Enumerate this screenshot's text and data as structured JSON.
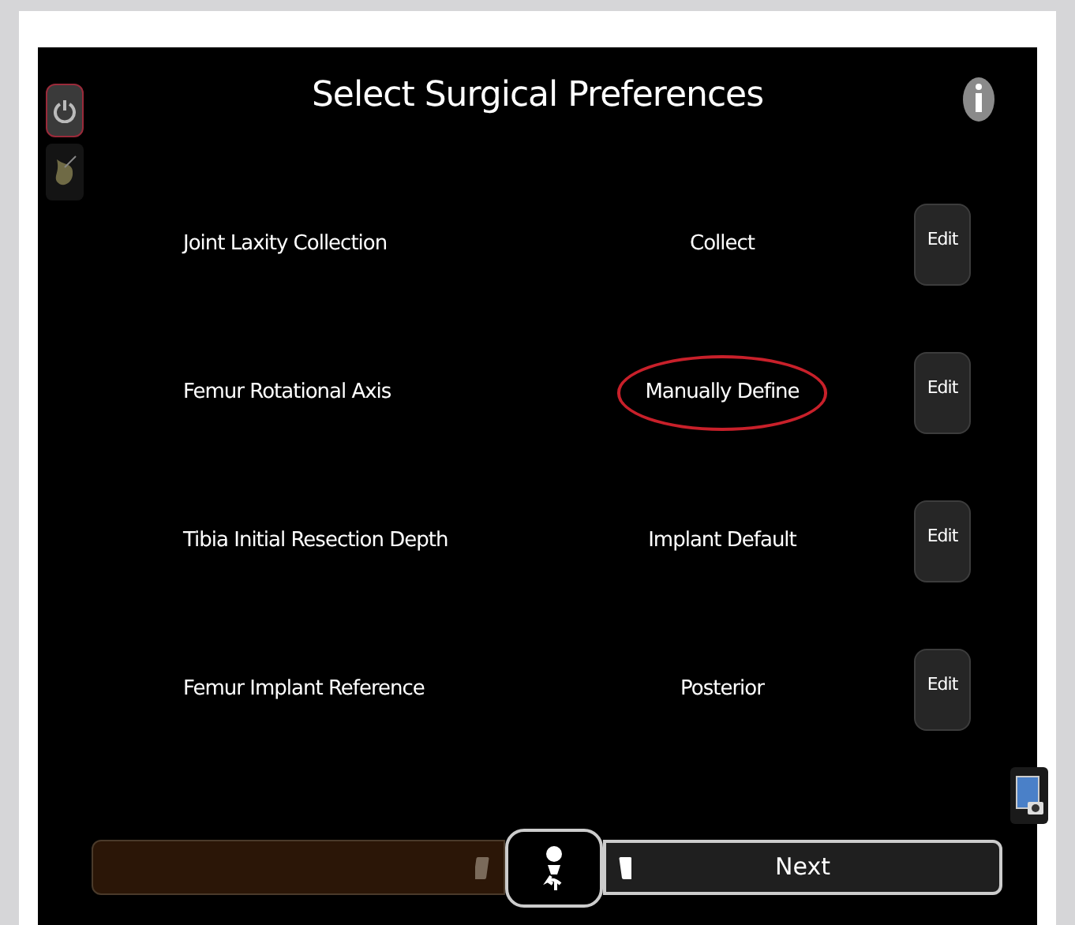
{
  "title": "Select Surgical Preferences",
  "preferences": [
    {
      "label": "Joint Laxity Collection",
      "value": "Collect",
      "button": "Edit",
      "highlighted": false
    },
    {
      "label": "Femur Rotational Axis",
      "value": "Manually Define",
      "button": "Edit",
      "highlighted": true
    },
    {
      "label": "Tibia Initial Resection Depth",
      "value": "Implant Default",
      "button": "Edit",
      "highlighted": false
    },
    {
      "label": "Femur Implant Reference",
      "value": "Posterior",
      "button": "Edit",
      "highlighted": false
    }
  ],
  "footer": {
    "next": "Next"
  }
}
